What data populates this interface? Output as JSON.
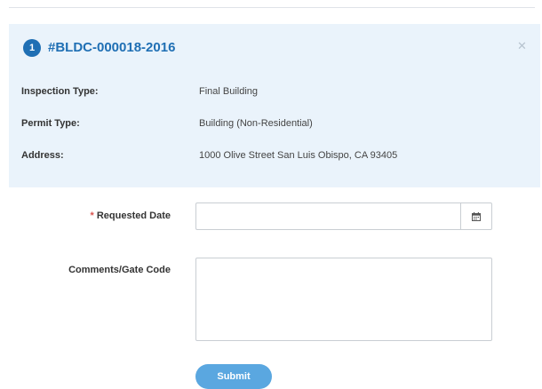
{
  "card": {
    "index": "1",
    "permit_id": "#BLDC-000018-2016",
    "close_glyph": "✕",
    "rows": [
      {
        "label": "Inspection Type:",
        "value": "Final Building"
      },
      {
        "label": "Permit Type:",
        "value": "Building (Non-Residential)"
      },
      {
        "label": "Address:",
        "value": "1000 Olive Street  San Luis Obispo, CA 93405"
      }
    ]
  },
  "form": {
    "requested_date": {
      "required_mark": "*",
      "label": "Requested Date",
      "value": "",
      "icon": "calendar-icon"
    },
    "comments": {
      "label": "Comments/Gate Code",
      "value": ""
    },
    "submit_label": "Submit"
  },
  "colors": {
    "accent": "#1f6fb4",
    "card_bg": "#eaf3fb",
    "submit_bg": "#5aa7e0",
    "required": "#d9534f"
  }
}
